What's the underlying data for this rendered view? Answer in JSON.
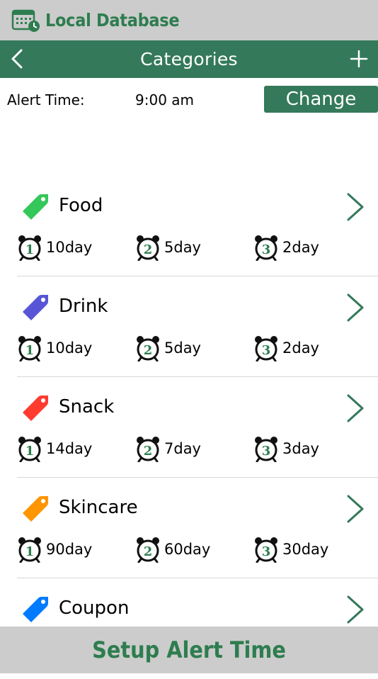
{
  "header": {
    "app_title": "Local Database"
  },
  "nav": {
    "title": "Categories"
  },
  "alert": {
    "label": "Alert Time:",
    "value": "9:00 am",
    "change_label": "Change"
  },
  "categories": [
    {
      "name": "Food",
      "color": "#34c759",
      "alerts": [
        {
          "num": "1",
          "days": "10day"
        },
        {
          "num": "2",
          "days": "5day"
        },
        {
          "num": "3",
          "days": "2day"
        }
      ]
    },
    {
      "name": "Drink",
      "color": "#5856d6",
      "alerts": [
        {
          "num": "1",
          "days": "10day"
        },
        {
          "num": "2",
          "days": "5day"
        },
        {
          "num": "3",
          "days": "2day"
        }
      ]
    },
    {
      "name": "Snack",
      "color": "#ff3b30",
      "alerts": [
        {
          "num": "1",
          "days": "14day"
        },
        {
          "num": "2",
          "days": "7day"
        },
        {
          "num": "3",
          "days": "3day"
        }
      ]
    },
    {
      "name": "Skincare",
      "color": "#ff9500",
      "alerts": [
        {
          "num": "1",
          "days": "90day"
        },
        {
          "num": "2",
          "days": "60day"
        },
        {
          "num": "3",
          "days": "30day"
        }
      ]
    },
    {
      "name": "Coupon",
      "color": "#007aff",
      "alerts": []
    }
  ],
  "footer": {
    "label": "Setup Alert Time"
  },
  "colors": {
    "primary_green": "#34795a",
    "gray_bar": "#cccccc",
    "title_green": "#2e7d4f"
  },
  "icons": {
    "app": "calendar-clock-icon",
    "back": "chevron-left-icon",
    "add": "plus-icon",
    "row": "chevron-right-icon",
    "tag": "price-tag-icon",
    "alarm": "alarm-clock-icon"
  }
}
